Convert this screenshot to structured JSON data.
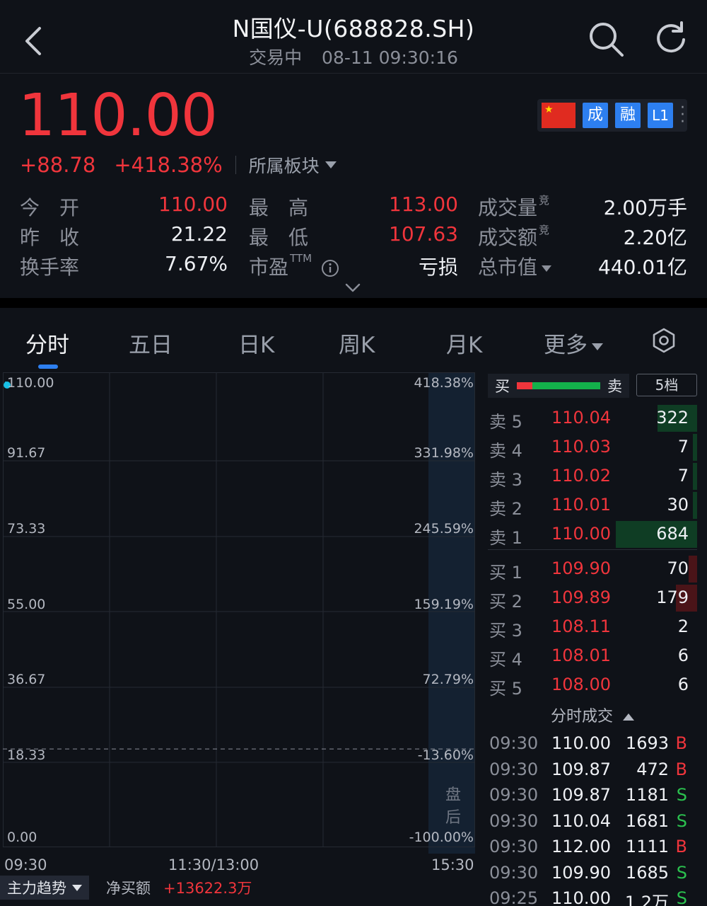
{
  "header": {
    "title": "N国仪-U(688828.SH)",
    "status": "交易中",
    "datetime": "08-11 09:30:16"
  },
  "quote": {
    "price": "110.00",
    "change": "+88.78",
    "change_pct": "+418.38%",
    "sector_label": "所属板块",
    "badges": [
      "成",
      "融",
      "L1"
    ]
  },
  "stats": {
    "open_label": "今　开",
    "open": "110.00",
    "high_label": "最　高",
    "high": "113.00",
    "volume_label": "成交量",
    "volume_sup": "竞",
    "volume": "2.00万手",
    "prev_close_label": "昨　收",
    "prev_close": "21.22",
    "low_label": "最　低",
    "low": "107.63",
    "amount_label": "成交额",
    "amount_sup": "竞",
    "amount": "2.20亿",
    "turnover_label": "换手率",
    "turnover": "7.67%",
    "pe_label": "市盈",
    "pe_sup": "TTM",
    "pe": "亏损",
    "mcap_label": "总市值",
    "mcap": "440.01亿"
  },
  "tabs": [
    "分时",
    "五日",
    "日K",
    "周K",
    "月K",
    "更多"
  ],
  "chart": {
    "y_left": [
      "110.00",
      "91.67",
      "73.33",
      "55.00",
      "36.67",
      "18.33",
      "0.00"
    ],
    "y_right": [
      "418.38%",
      "331.98%",
      "245.59%",
      "159.19%",
      "72.79%",
      "-13.60%",
      "-100.00%"
    ],
    "x_labels": [
      "09:30",
      "11:30/13:00",
      "15:30"
    ],
    "after_hours_label": "盘后"
  },
  "chart_data": {
    "type": "line",
    "title": "",
    "xlabel": "",
    "ylabel": "",
    "x": [
      "09:30"
    ],
    "series": [
      {
        "values": [
          110.0
        ]
      }
    ],
    "ylim": [
      0,
      110
    ],
    "reference_line": 21.22,
    "grid": true
  },
  "bottom": {
    "trend_label": "主力趋势",
    "net_label": "净买额",
    "net_value": "+13622.3万"
  },
  "book": {
    "buy_label": "买",
    "sell_label": "卖",
    "buy_ratio": 0.12,
    "level_button": "5档",
    "asks": [
      {
        "level": "卖 5",
        "price": "110.04",
        "vol": "322",
        "bar": 0.19
      },
      {
        "level": "卖 4",
        "price": "110.03",
        "vol": "7",
        "bar": 0.02
      },
      {
        "level": "卖 3",
        "price": "110.02",
        "vol": "7",
        "bar": 0.02
      },
      {
        "level": "卖 2",
        "price": "110.01",
        "vol": "30",
        "bar": 0.02
      },
      {
        "level": "卖 1",
        "price": "110.00",
        "vol": "684",
        "bar": 0.39
      }
    ],
    "bids": [
      {
        "level": "买 1",
        "price": "109.90",
        "vol": "70",
        "bar": 0.04
      },
      {
        "level": "买 2",
        "price": "109.89",
        "vol": "179",
        "bar": 0.1
      },
      {
        "level": "买 3",
        "price": "108.11",
        "vol": "2",
        "bar": 0
      },
      {
        "level": "买 4",
        "price": "108.01",
        "vol": "6",
        "bar": 0
      },
      {
        "level": "买 5",
        "price": "108.00",
        "vol": "6",
        "bar": 0
      }
    ],
    "ticks_label": "分时成交",
    "ticks": [
      {
        "time": "09:30",
        "price": "110.00",
        "vol": "1693",
        "dir": "B"
      },
      {
        "time": "09:30",
        "price": "109.87",
        "vol": "472",
        "dir": "B"
      },
      {
        "time": "09:30",
        "price": "109.87",
        "vol": "1181",
        "dir": "S"
      },
      {
        "time": "09:30",
        "price": "110.04",
        "vol": "1681",
        "dir": "S"
      },
      {
        "time": "09:30",
        "price": "112.00",
        "vol": "1111",
        "dir": "B"
      },
      {
        "time": "09:30",
        "price": "109.90",
        "vol": "1685",
        "dir": "S"
      },
      {
        "time": "09:25",
        "price": "110.00",
        "vol": "1.2万",
        "dir": "S"
      }
    ]
  },
  "colors": {
    "up": "#f0353c",
    "down": "#2bc14f",
    "accent": "#2d7ff0",
    "background": "#0f1218"
  }
}
